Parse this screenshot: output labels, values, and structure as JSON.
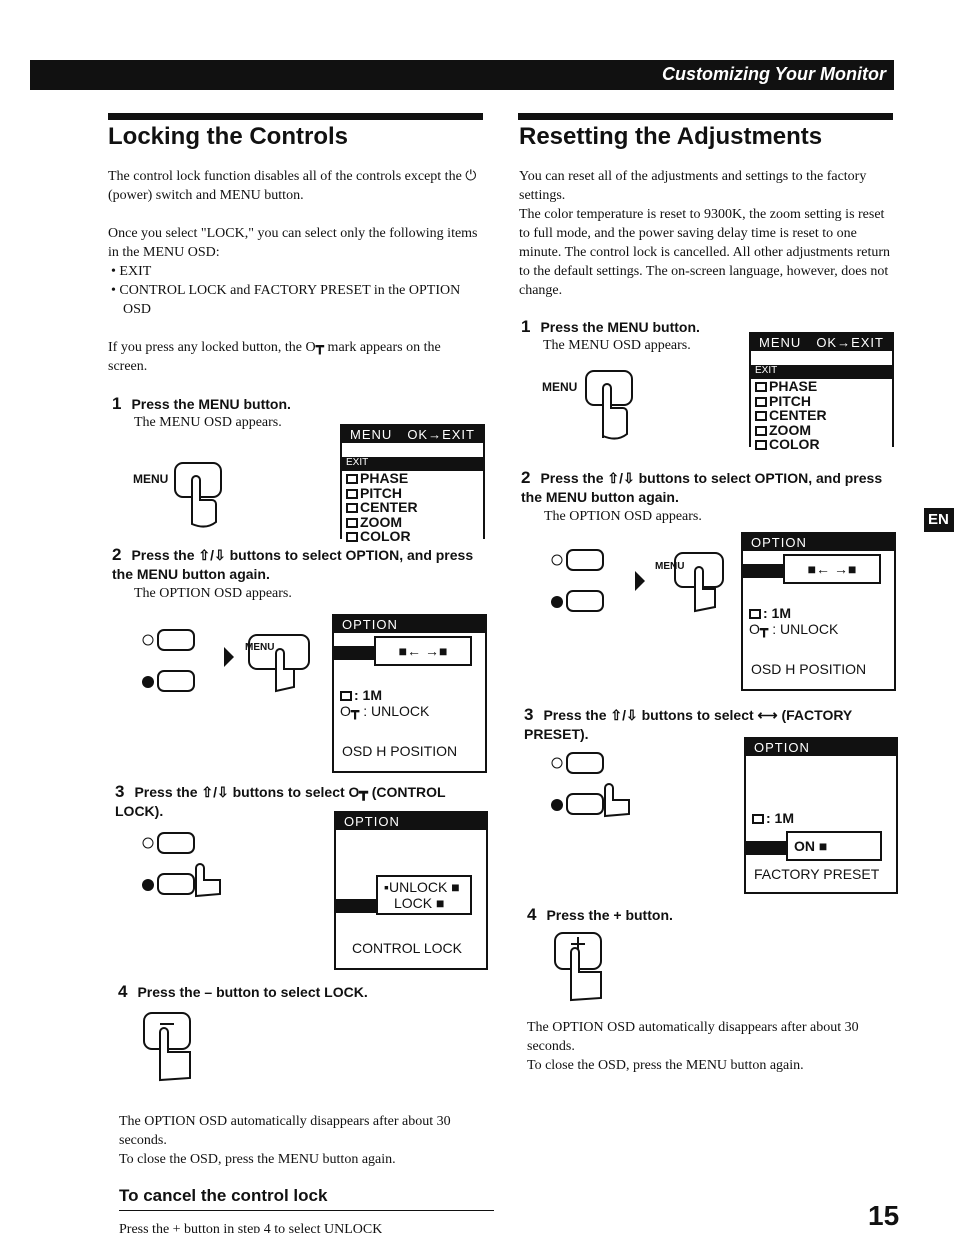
{
  "header": {
    "section": "Customizing Your Monitor"
  },
  "tab": "EN",
  "page_number": "15",
  "left": {
    "title": "Locking the Controls",
    "intro": "The control lock function disables all of the controls except the ⏻ (power) switch and MENU button.",
    "p2": "Once you select \"LOCK,\" you can select only the following items in the MENU OSD:",
    "bullets": [
      "EXIT",
      "CONTROL LOCK and FACTORY PRESET in the OPTION OSD"
    ],
    "p3": "If you press any locked button, the O┳ mark appears on the screen.",
    "steps": [
      {
        "num": "1",
        "title": "Press the MENU button.",
        "desc": "The MENU OSD appears."
      },
      {
        "num": "2",
        "title": "Press the ⇧/⇩ buttons to select OPTION, and press the MENU button again.",
        "desc": "The OPTION OSD appears."
      },
      {
        "num": "3",
        "title": "Press the ⇧/⇩ buttons to select O┳ (CONTROL LOCK)."
      },
      {
        "num": "4",
        "title": "Press the – button to select LOCK."
      }
    ],
    "outro1": "The OPTION OSD automatically disappears after about 30 seconds.",
    "outro2": "To close the OSD, press the MENU button again.",
    "subhead": "To cancel the control lock",
    "cut_line": "Press the + button in step 4 to select UNLOCK"
  },
  "right": {
    "title": "Resetting the Adjustments",
    "intro": "You can reset all of the adjustments and settings to the factory settings.",
    "p2": "The color temperature is reset to 9300K, the zoom setting is reset to full mode, and the power saving delay time is reset to one minute. The control lock is cancelled. All other adjustments return to the default settings. The on-screen language, however, does not change.",
    "steps": [
      {
        "num": "1",
        "title": "Press the MENU button.",
        "desc": "The MENU OSD appears."
      },
      {
        "num": "2",
        "title": "Press the ⇧/⇩ buttons to select OPTION, and press the MENU button again.",
        "desc": "The OPTION OSD appears."
      },
      {
        "num": "3",
        "title": "Press the ⇧/⇩ buttons to select ⟷ (FACTORY PRESET)."
      },
      {
        "num": "4",
        "title": "Press the + button."
      }
    ],
    "outro1": "The OPTION OSD automatically disappears after about 30 seconds.",
    "outro2": "To close the OSD, press the MENU button again."
  },
  "osd": {
    "menu_title": "MENU",
    "menu_ok": "OK→EXIT",
    "exit": "EXIT",
    "menu_items": [
      "PHASE",
      "PITCH",
      "CENTER",
      "ZOOM",
      "COLOR"
    ],
    "option_title": "OPTION",
    "value_1m": ": 1M",
    "value_unlock": ": UNLOCK",
    "hpos": "OSD H POSITION",
    "unlock": "UNLOCK",
    "lock": "LOCK",
    "control_lock": "CONTROL LOCK",
    "on": "ON",
    "factory_preset": "FACTORY PRESET"
  },
  "labels": {
    "menu": "MENU"
  }
}
